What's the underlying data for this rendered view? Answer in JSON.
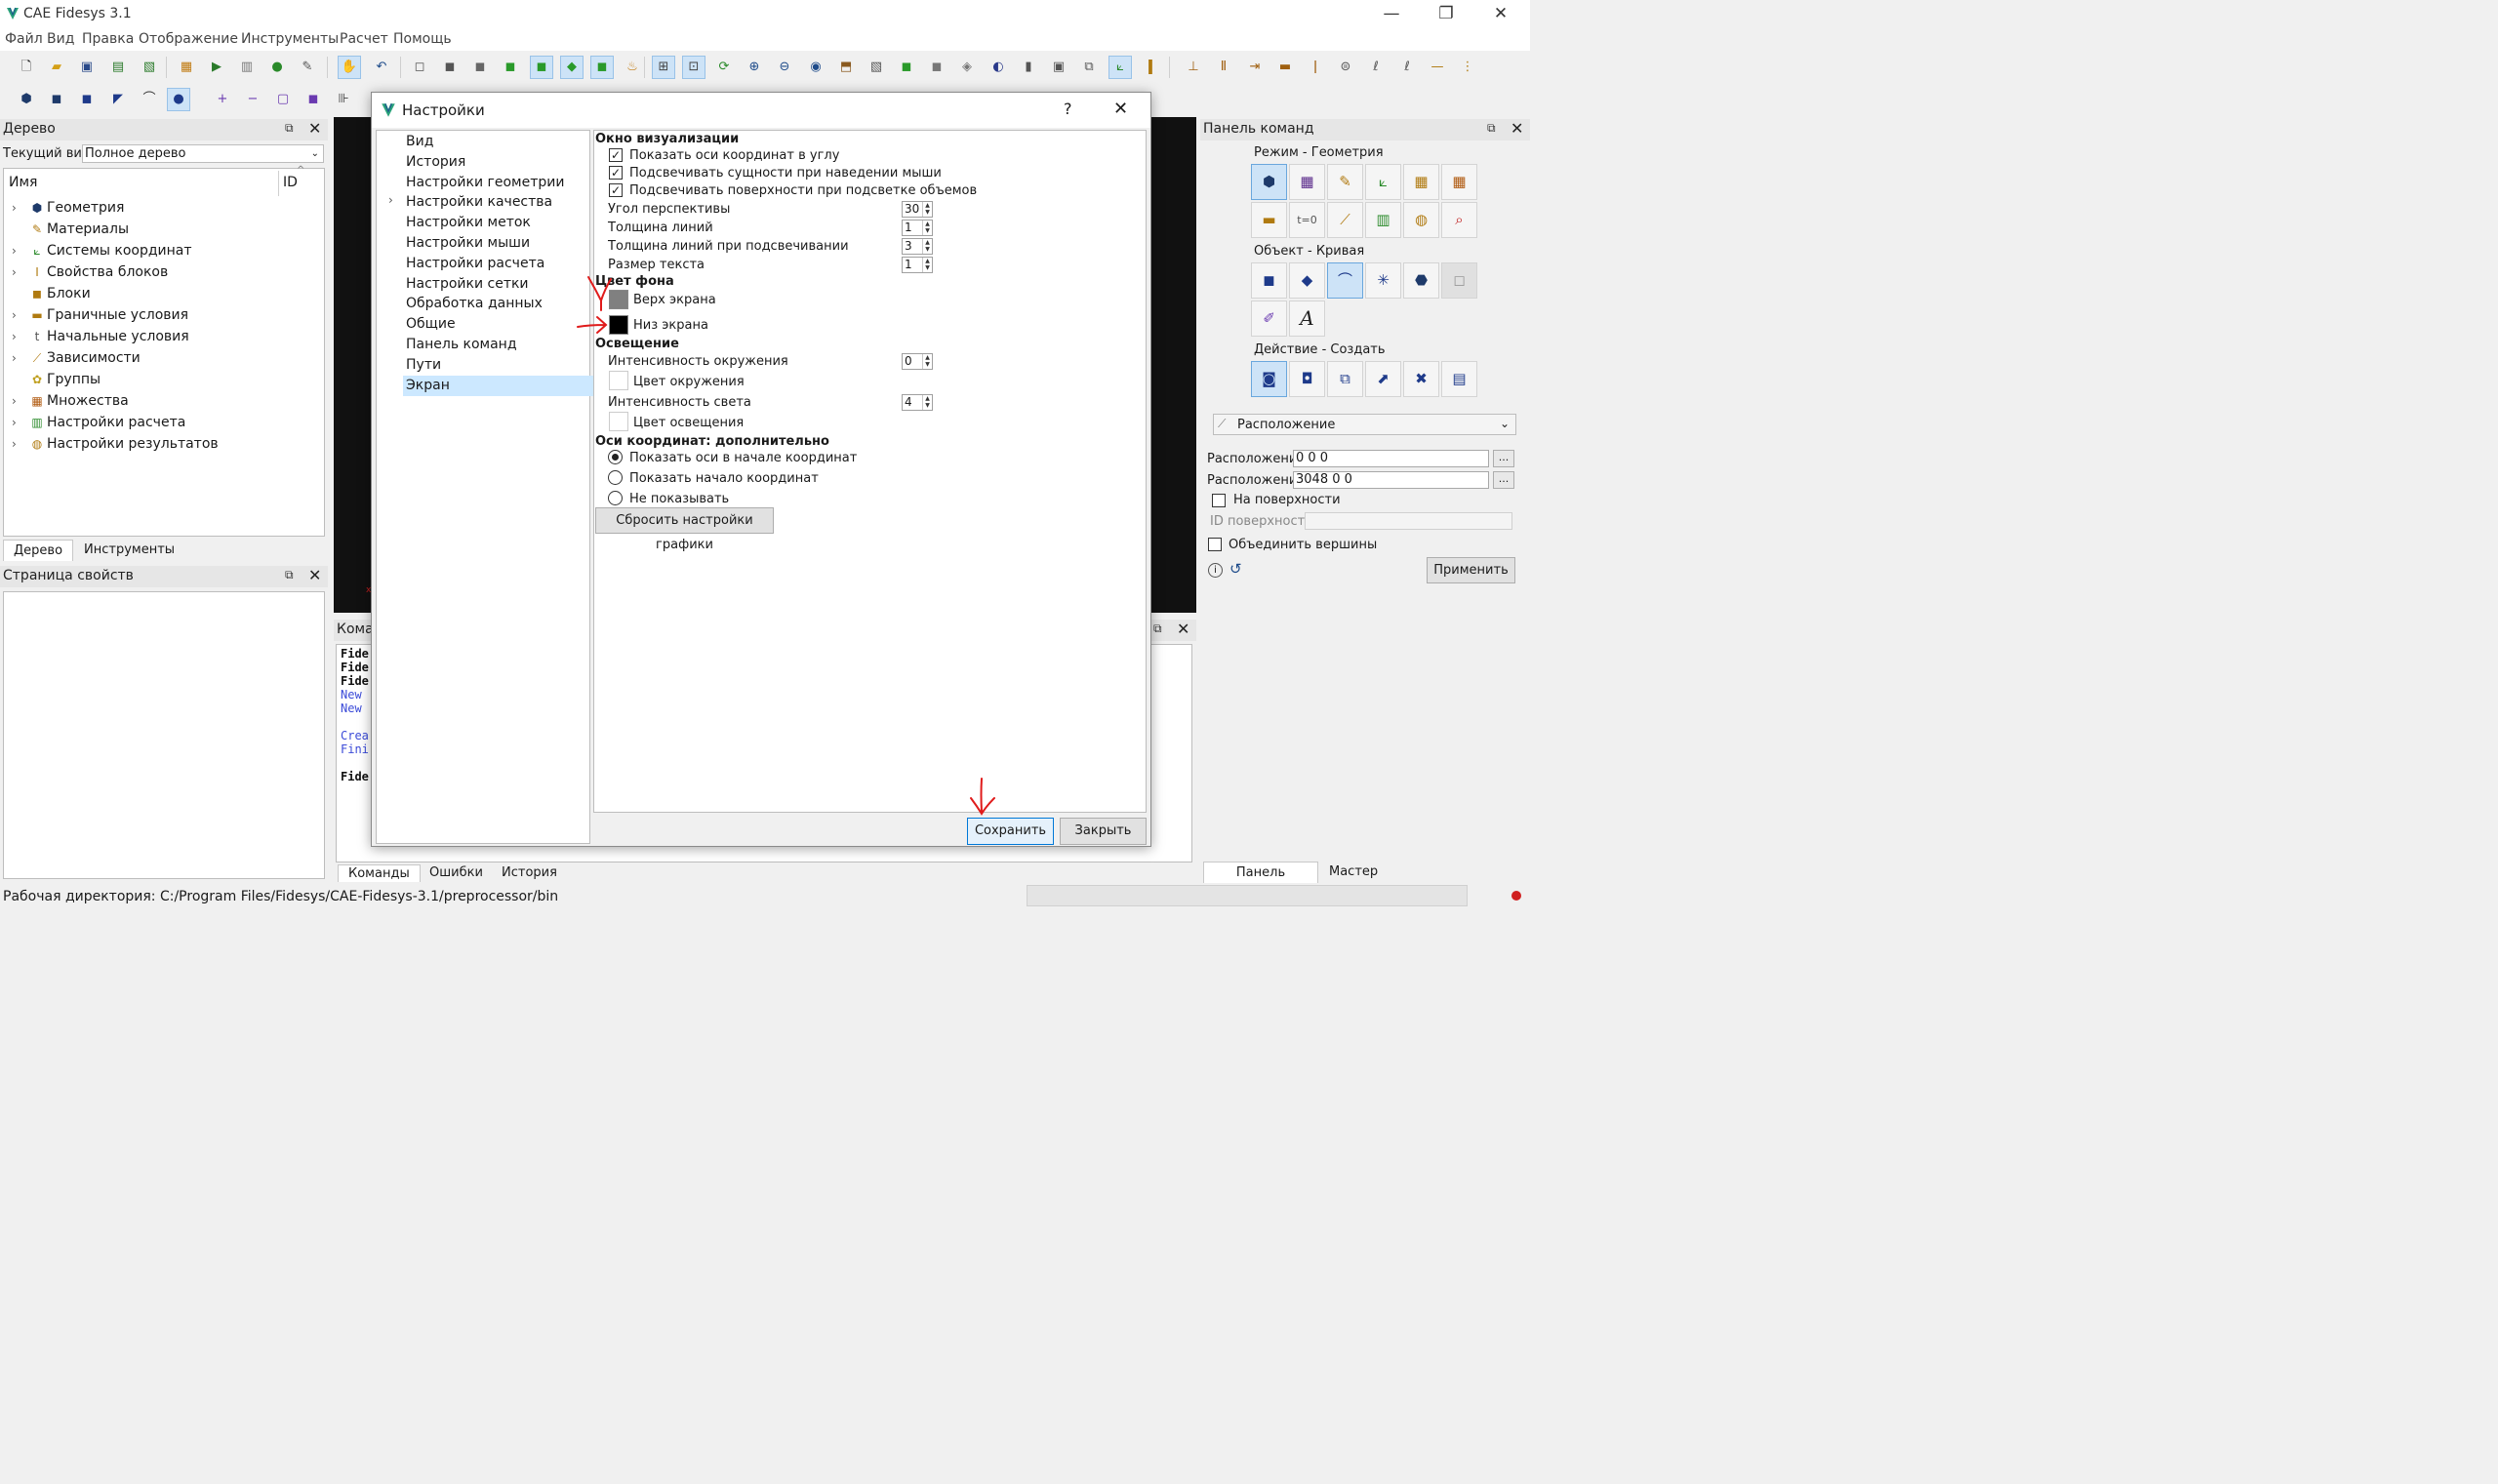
{
  "app": {
    "title": "CAE Fidesys 3.1",
    "window_controls": {
      "minimize": "—",
      "maximize": "❐",
      "close": "✕"
    }
  },
  "menu": [
    "Файл",
    "Вид",
    "Правка",
    "Отображение",
    "Инструменты",
    "Расчет",
    "Помощь"
  ],
  "tree_panel": {
    "title": "Дерево",
    "current_view_label": "Текущий вид",
    "current_view_value": "Полное дерево",
    "col_name": "Имя",
    "col_id": "ID",
    "items": [
      {
        "label": "Геометрия",
        "expandable": true,
        "icon": "geometry-icon"
      },
      {
        "label": "Материалы",
        "expandable": false,
        "icon": "materials-icon"
      },
      {
        "label": "Системы координат",
        "expandable": true,
        "icon": "coordinate-systems-icon"
      },
      {
        "label": "Свойства блоков",
        "expandable": true,
        "icon": "block-properties-icon"
      },
      {
        "label": "Блоки",
        "expandable": false,
        "icon": "blocks-icon"
      },
      {
        "label": "Граничные условия",
        "expandable": true,
        "icon": "boundary-conditions-icon"
      },
      {
        "label": "Начальные условия",
        "expandable": true,
        "icon": "initial-conditions-icon"
      },
      {
        "label": "Зависимости",
        "expandable": true,
        "icon": "dependencies-icon"
      },
      {
        "label": "Группы",
        "expandable": false,
        "icon": "groups-icon"
      },
      {
        "label": "Множества",
        "expandable": true,
        "icon": "sets-icon"
      },
      {
        "label": "Настройки расчета",
        "expandable": true,
        "icon": "calc-settings-icon"
      },
      {
        "label": "Настройки результатов",
        "expandable": true,
        "icon": "results-settings-icon"
      }
    ],
    "tabs": [
      "Дерево",
      "Инструменты"
    ]
  },
  "properties_panel": {
    "title": "Страница свойств"
  },
  "console": {
    "title": "Кома",
    "lines": [
      {
        "text": "Fide",
        "bold": true,
        "color": "#111111"
      },
      {
        "text": "Fide",
        "bold": true,
        "color": "#111111"
      },
      {
        "text": "Fide",
        "bold": true,
        "color": "#111111"
      },
      {
        "text": "New ",
        "bold": false,
        "color": "#3b4bd8"
      },
      {
        "text": "New ",
        "bold": false,
        "color": "#3b4bd8"
      },
      {
        "text": "",
        "bold": false,
        "color": "#111111"
      },
      {
        "text": "Crea",
        "bold": false,
        "color": "#3b4bd8"
      },
      {
        "text": "Fini",
        "bold": false,
        "color": "#3b4bd8"
      },
      {
        "text": "",
        "bold": false,
        "color": "#111111"
      },
      {
        "text": "Fide",
        "bold": true,
        "color": "#111111"
      }
    ],
    "tabs": [
      "Команды",
      "Ошибки",
      "История"
    ]
  },
  "dialog": {
    "title": "Настройки",
    "help": "?",
    "close": "✕",
    "nav": [
      {
        "label": "Вид",
        "expandable": false,
        "selected": false
      },
      {
        "label": "История",
        "expandable": false,
        "selected": false
      },
      {
        "label": "Настройки геометрии",
        "expandable": false,
        "selected": false
      },
      {
        "label": "Настройки качества",
        "expandable": true,
        "selected": false
      },
      {
        "label": "Настройки меток",
        "expandable": false,
        "selected": false
      },
      {
        "label": "Настройки мыши",
        "expandable": false,
        "selected": false
      },
      {
        "label": "Настройки расчета",
        "expandable": false,
        "selected": false
      },
      {
        "label": "Настройки сетки",
        "expandable": false,
        "selected": false
      },
      {
        "label": "Обработка данных",
        "expandable": false,
        "selected": false
      },
      {
        "label": "Общие",
        "expandable": false,
        "selected": false
      },
      {
        "label": "Панель команд",
        "expandable": false,
        "selected": false
      },
      {
        "label": "Пути",
        "expandable": false,
        "selected": false
      },
      {
        "label": "Экран",
        "expandable": false,
        "selected": true
      }
    ],
    "viz_title": "Окно визуализации",
    "checkboxes": [
      {
        "label": "Показать оси координат в углу",
        "checked": true
      },
      {
        "label": "Подсвечивать сущности при наведении мыши",
        "checked": true
      },
      {
        "label": "Подсвечивать поверхности при подсветке объемов",
        "checked": true
      }
    ],
    "spins": [
      {
        "label": "Угол перспективы",
        "value": "30"
      },
      {
        "label": "Толщина линий",
        "value": "1"
      },
      {
        "label": "Толщина линий при подсвечивании",
        "value": "3"
      },
      {
        "label": "Размер текста",
        "value": "1"
      }
    ],
    "bg_title": "Цвет фона",
    "bg_top_label": "Верх экрана",
    "bg_top_color": "#808080",
    "bg_bottom_label": "Низ экрана",
    "bg_bottom_color": "#000000",
    "light_title": "Освещение",
    "ambient_intensity_label": "Интенсивность окружения",
    "ambient_intensity_value": "0",
    "ambient_color_label": "Цвет окружения",
    "ambient_color": "#ffffff",
    "light_intensity_label": "Интенсивность света",
    "light_intensity_value": "4",
    "light_color_label": "Цвет освещения",
    "light_color": "#ffffff",
    "axes_title": "Оси координат: дополнительно",
    "radios": [
      {
        "label": "Показать оси в начале координат",
        "checked": true
      },
      {
        "label": "Показать начало координат",
        "checked": false
      },
      {
        "label": "Не показывать",
        "checked": false
      }
    ],
    "reset_label": "Сбросить настройки графики",
    "save_label": "Сохранить",
    "close_label": "Закрыть"
  },
  "command_panel": {
    "title": "Панель команд",
    "mode_title": "Режим - Геометрия",
    "object_title": "Объект - Кривая",
    "action_title": "Действие - Создать",
    "dropdown_value": "Расположение",
    "location1_label": "Расположение",
    "location1_value": "0 0 0",
    "location2_label": "Расположение",
    "location2_value": "3048 0 0",
    "on_surface_label": "На поверхности",
    "surface_id_label": "ID поверхности",
    "merge_vertices_label": "Объединить вершины",
    "apply_label": "Применить",
    "tabs": [
      "Панель команд",
      "Мастер"
    ]
  },
  "status": {
    "working_dir": "Рабочая директория: C:/Program Files/Fidesys/CAE-Fidesys-3.1/preprocessor/bin"
  },
  "colors": {
    "accent": "#0078d7",
    "selection": "#cce8ff",
    "annotation_red": "#e01b1b"
  }
}
